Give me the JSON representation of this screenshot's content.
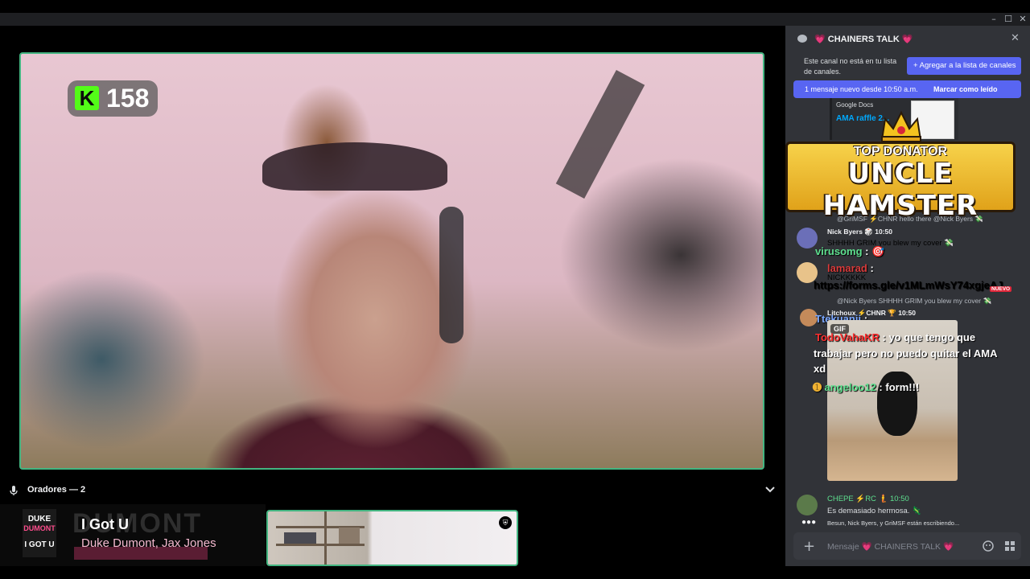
{
  "window": {
    "minimize": "–",
    "maximize": "☐",
    "close": "✕"
  },
  "stream": {
    "kick_count": "158",
    "kick_logo": "K"
  },
  "speakers": {
    "label": "Oradores — 2"
  },
  "now_playing": {
    "cover_lines": [
      "DUKE",
      "DUMONT",
      "I GOT U"
    ],
    "ghost_text": "DUMONT",
    "title": "I Got U",
    "artist": "Duke Dumont, Jax Jones"
  },
  "chat": {
    "channel_name": "💗 CHAINERS TALK 💗",
    "notice": "Este canal no está en tu lista de canales.",
    "add_button": "+ Agregar a la lista de canales",
    "new_message": "1 mensaje nuevo desde 10:50 a.m.",
    "mark_read": "Marcar como leído",
    "embed": {
      "source": "Google Docs",
      "title": "AMA raffle 2..."
    },
    "donator": {
      "subtitle": "TOP DONATOR",
      "name": "UNCLE HAMSTER"
    },
    "messages": [
      {
        "text": "@GriMSF ⚡CHNR hello there @Nick Byers 💸"
      },
      {
        "text": "Nick Byers 🎲 10:50"
      },
      {
        "text": "SHHHH GRIM you blew my cover 💸"
      },
      {
        "text": "NICKKKKK"
      },
      {
        "text": "@Nick Byers SHHHH GRIM you blew my cover 💸"
      },
      {
        "text": "Litchoux ⚡CHNR 🏆 10:50"
      },
      {
        "text": "CHEPE ⚡RC 🧜 10:50"
      },
      {
        "text": "Es demasiado hermosa. 🦎"
      }
    ],
    "overlay": [
      {
        "user": "virusomg",
        "text": " : 🎯",
        "color": "#5ee08f"
      },
      {
        "user": "lamarad",
        "text": " :",
        "color": "#d83a3a"
      },
      {
        "user": "https://forms.gle/v1MLmWsY74xgjeAJ",
        "text": "",
        "color": "#b18cff"
      },
      {
        "user": "Ttekuanii",
        "text": " :",
        "color": "#7aa7ff"
      },
      {
        "user": "TodoVahaKR",
        "text": " : yo que tengo que",
        "color": "#ff3030"
      },
      {
        "user": "",
        "text": "trabajar pero no puedo quitar el AMA",
        "color": "#ffffff"
      },
      {
        "user": "",
        "text": "xd",
        "color": "#ffffff"
      },
      {
        "user": "angeloo12",
        "text": " : form!!!",
        "color": "#5ee08f"
      }
    ],
    "gif_label": "GIF",
    "new_badge": "NUEVO",
    "typing": "Besun, Nick Byers, y GriMSF están escribiendo...",
    "composer_placeholder": "Mensaje 💗 CHAINERS TALK 💗"
  }
}
